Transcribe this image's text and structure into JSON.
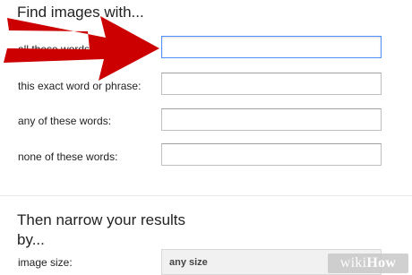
{
  "sections": {
    "find_heading": "Find images with...",
    "narrow_heading": "Then narrow your results by..."
  },
  "fields": [
    {
      "label": "all these words:",
      "value": ""
    },
    {
      "label": "this exact word or phrase:",
      "value": ""
    },
    {
      "label": "any of these words:",
      "value": ""
    },
    {
      "label": "none of these words:",
      "value": ""
    }
  ],
  "image_size": {
    "label": "image size:",
    "selected": "any size"
  },
  "annotation": {
    "arrow_color": "#cc0000"
  },
  "watermark": {
    "wiki": "wiki",
    "how": "How"
  },
  "colors": {
    "focus_border": "#4d90fe"
  }
}
